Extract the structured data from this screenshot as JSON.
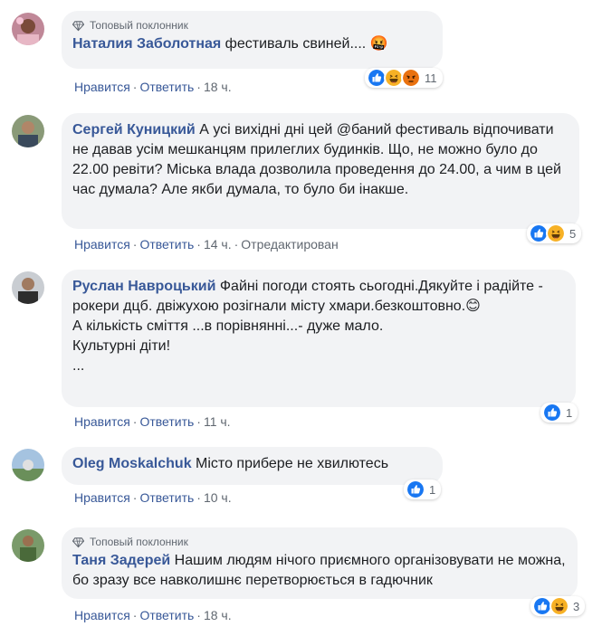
{
  "actions": {
    "like": "Нравится",
    "reply": "Ответить",
    "edited": "Отредактирован"
  },
  "badge_top_fan": "Топовый поклонник",
  "comments": [
    {
      "author": "Наталия Заболотная",
      "text": "фестиваль свиней.... 🤬",
      "time": "18 ч.",
      "reactions": [
        "like",
        "haha",
        "angry"
      ],
      "reaction_count": "11"
    },
    {
      "author": "Сергей Куницкий",
      "text": "А усі вихідні дні цей @баний фестиваль відпочивати не давав усім мешканцям прилеглих будинків. Що, не можно було до 22.00 ревіти? Міська влада дозволила проведення до 24.00, а чим в цей час думала? Але якби думала, то було би інакше.",
      "time": "14 ч.",
      "reactions": [
        "like",
        "haha"
      ],
      "reaction_count": "5"
    },
    {
      "author": "Руслан Навроцький",
      "text_lines": [
        "Файні погоди стоять сьогодні.Дякуйте і радійте - рокери дцб. двіжухою розігнали місту хмари.безкоштовно.😊",
        "А кількість сміття ...в порівнянні...- дуже мало.",
        "Культурні діти!",
        "..."
      ],
      "time": "11 ч.",
      "reactions": [
        "like"
      ],
      "reaction_count": "1"
    },
    {
      "author": "Oleg Moskalchuk",
      "text": "Місто прибере не хвилютесь",
      "time": "10 ч.",
      "reactions": [
        "like"
      ],
      "reaction_count": "1"
    },
    {
      "author": "Таня Задерей",
      "text": "Нашим людям нічого приємного організовувати не можна, бо зразу все навколишнє перетворюється в гадючник",
      "time": "18 ч.",
      "reactions": [
        "like",
        "haha"
      ],
      "reaction_count": "3"
    }
  ]
}
